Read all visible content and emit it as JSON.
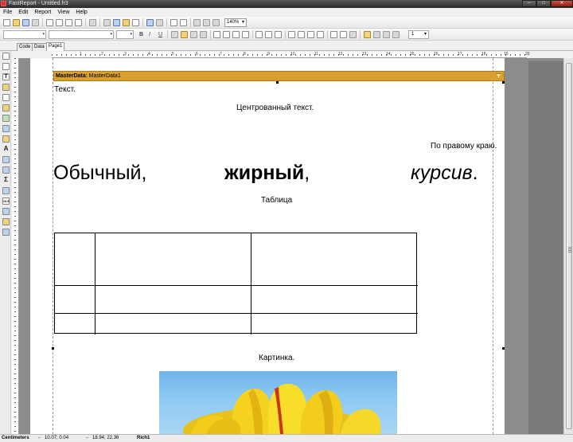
{
  "window": {
    "title": "FastReport - Untitled.fr3",
    "min": "─",
    "max": "□",
    "close": "✕"
  },
  "menu": [
    "File",
    "Edit",
    "Report",
    "View",
    "Help"
  ],
  "toolbar": {
    "zoom": "140%",
    "font_size": "",
    "line_width": "1"
  },
  "tabs": [
    "Code",
    "Data",
    "Page1"
  ],
  "ruler": {
    "h": [
      "1",
      "2",
      "3",
      "4",
      "5",
      "6",
      "7",
      "8",
      "9",
      "10",
      "11",
      "12",
      "13",
      "14",
      "15",
      "16",
      "17",
      "18",
      "19",
      "20"
    ]
  },
  "band": {
    "type": "MasterData",
    "name": ": MasterData1"
  },
  "report": {
    "text_plain": "Текст.",
    "text_center": "Центрованный текст.",
    "text_right": "По правому краю.",
    "normal": "Обычный,",
    "bold": "жирный",
    "comma": ",",
    "italic": "курсив",
    "period": ".",
    "table_caption": "Таблица",
    "picture_caption": "Картинка."
  },
  "left_tools": [
    "select",
    "hand",
    "zoom",
    "text",
    "brush",
    "band",
    "subreport",
    "check",
    "chart",
    "image",
    "text-A",
    "picture",
    "copy",
    "sigma",
    "line",
    "barcode",
    "rich",
    "ole",
    "cross",
    "gauge"
  ],
  "status": {
    "units": "Centimeters",
    "pos1": "10.07; 0.04",
    "pos2": "18.94; 22.36",
    "object": "Rich1"
  }
}
